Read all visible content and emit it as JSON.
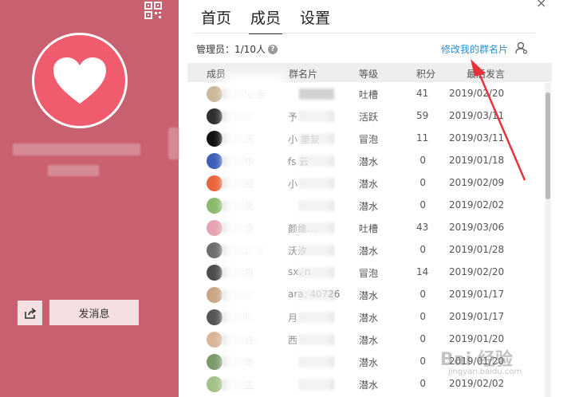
{
  "tabs": [
    {
      "label": "首页",
      "active": false
    },
    {
      "label": "成员",
      "active": true
    },
    {
      "label": "设置",
      "active": false
    }
  ],
  "close_label": "×",
  "admin": {
    "text": "管理员：1/10人",
    "help": "?"
  },
  "edit_card_label": "修改我的群名片",
  "send_message_label": "发消息",
  "columns": {
    "member": "成员",
    "card": "群名片",
    "level": "等级",
    "points": "积分",
    "last_post": "最后发言"
  },
  "rows": [
    {
      "member": "'u'香",
      "card": "",
      "level": "吐槽",
      "points": "41",
      "date": "2019/02/20",
      "avatar": "#cbb79a"
    },
    {
      "member": "",
      "card": "予",
      "level": "活跃",
      "points": "59",
      "date": "2019/03/11",
      "avatar": "#2f2f2f"
    },
    {
      "member": "天",
      "card": "小    重复",
      "level": "冒泡",
      "points": "11",
      "date": "2019/03/11",
      "avatar": "#111111"
    },
    {
      "member": "中",
      "card": "fs    云",
      "level": "潜水",
      "points": "0",
      "date": "2019/01/18",
      "avatar": "#3d5db8"
    },
    {
      "member": "虹",
      "card": "小",
      "level": "潜水",
      "points": "0",
      "date": "2019/02/09",
      "avatar": "#e8643a"
    },
    {
      "member": "笑",
      "card": "",
      "level": "潜水",
      "points": "0",
      "date": "2019/02/02",
      "avatar": "#8cb86b"
    },
    {
      "member": "夕",
      "card": "    颜维...",
      "level": "吐槽",
      "points": "43",
      "date": "2019/03/06",
      "avatar": "#e6a3b1"
    },
    {
      "member": "、 2.",
      "card": "沃汐",
      "level": "潜水",
      "points": "0",
      "date": "2019/01/28",
      "avatar": "#6d6d6d"
    },
    {
      "member": "舟",
      "card": "sx.    n",
      "level": "冒泡",
      "points": "14",
      "date": "2019/02/20",
      "avatar": "#4b4b4b"
    },
    {
      "member": "",
      "card": "ara.    40726",
      "level": "潜水",
      "points": "0",
      "date": "2019/01/17",
      "avatar": "#c9a585"
    },
    {
      "member": "l",
      "card": "月",
      "level": "潜水",
      "points": "0",
      "date": "2019/01/17",
      "avatar": "#555555"
    },
    {
      "member": "许。",
      "card": "西",
      "level": "潜水",
      "points": "0",
      "date": "2019/01/20",
      "avatar": "#d9b59a"
    },
    {
      "member": "丰",
      "card": "",
      "level": "潜水",
      "points": "0",
      "date": "2019/01/20",
      "avatar": "#7a9a6a"
    },
    {
      "member": "生",
      "card": "",
      "level": "潜水",
      "points": "0",
      "date": "2019/02/02",
      "avatar": "#a4c08a"
    }
  ],
  "watermark": {
    "brand": "Bai 经验",
    "url": "jingyan.baidu.com"
  },
  "colors": {
    "sidebar": "#c9606f",
    "avatar_ring": "#f05b6e",
    "link": "#2a8fd0",
    "arrow": "#e8323a"
  },
  "icons": {
    "qr": "qr-code-icon",
    "heart": "heart-icon",
    "share": "share-icon",
    "help": "help-circle-icon",
    "member_settings": "member-settings-icon"
  }
}
